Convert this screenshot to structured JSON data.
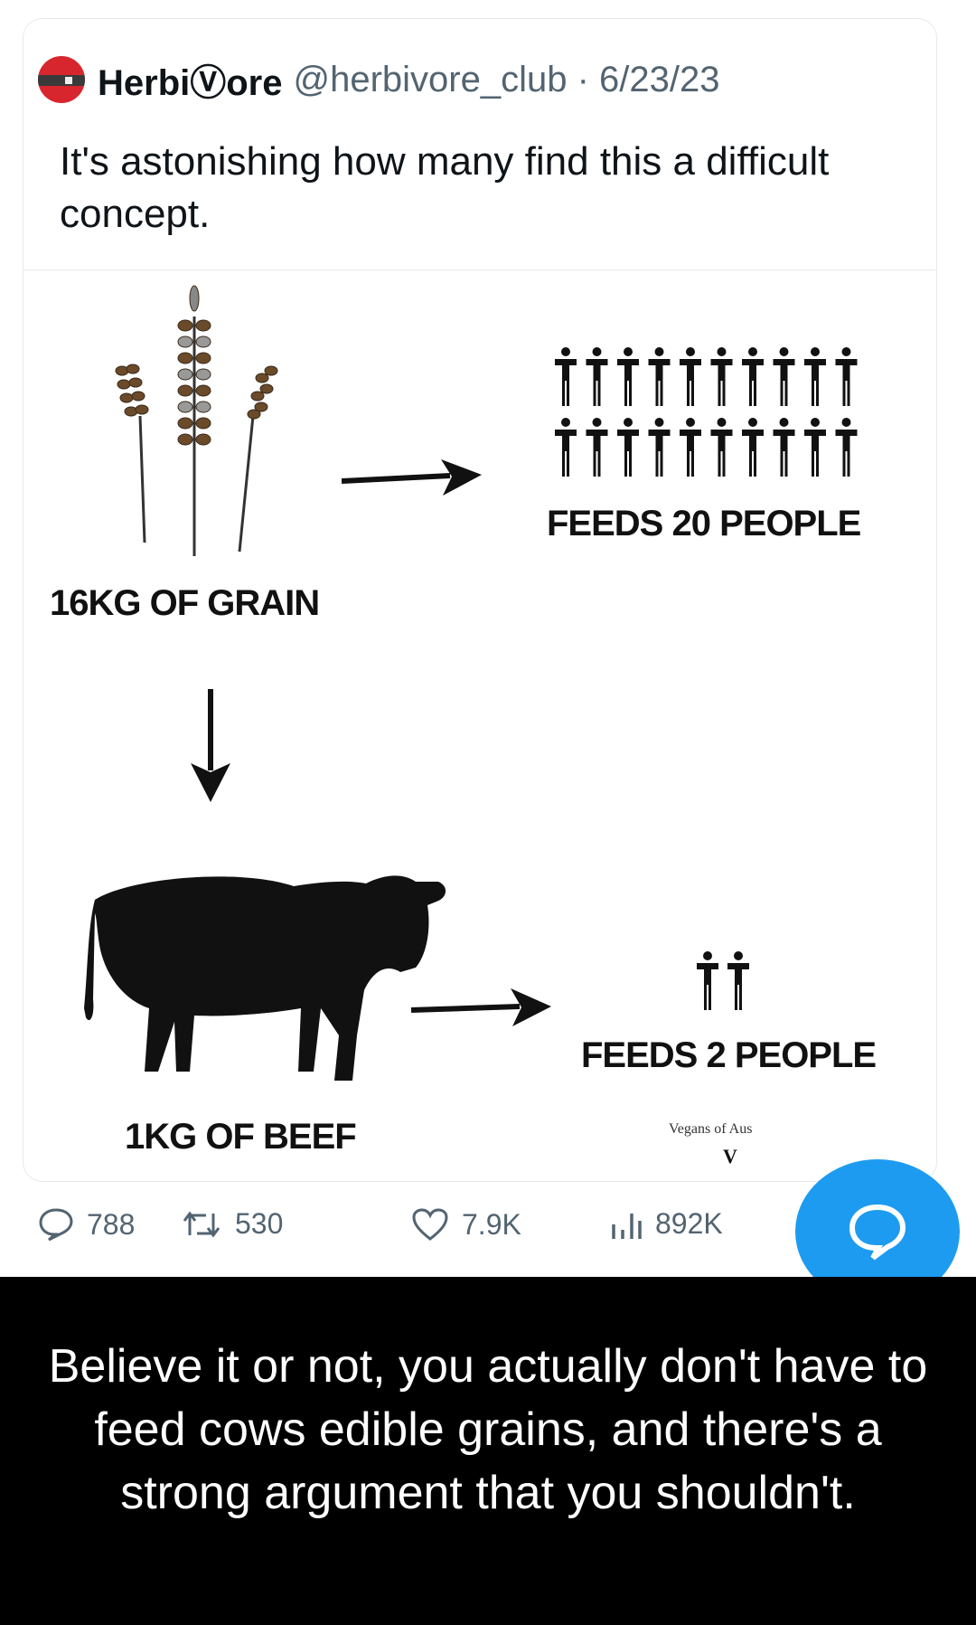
{
  "tweet": {
    "display_name": "HerbiⓋore",
    "handle": "@herbivore_club",
    "date": "6/23/23",
    "text": "It's astonishing how many find this a difficult concept."
  },
  "infographic": {
    "grain_label": "16KG OF GRAIN",
    "grain_feeds": "FEEDS 20 PEOPLE",
    "grain_people_count": 20,
    "beef_label": "1KG OF BEEF",
    "beef_feeds": "FEEDS 2 PEOPLE",
    "beef_people_count": 2,
    "credit": "Vegans of Aus",
    "credit_mark": "V"
  },
  "actions": {
    "replies": "788",
    "retweets": "530",
    "likes": "7.9K",
    "views": "892K"
  },
  "colors": {
    "accent": "#1d9bf0",
    "muted_text": "#536471",
    "caption_bg": "#000000"
  },
  "caption": "Believe it or not, you actually don't have to feed cows edible grains, and there's a strong argument that you shouldn't."
}
